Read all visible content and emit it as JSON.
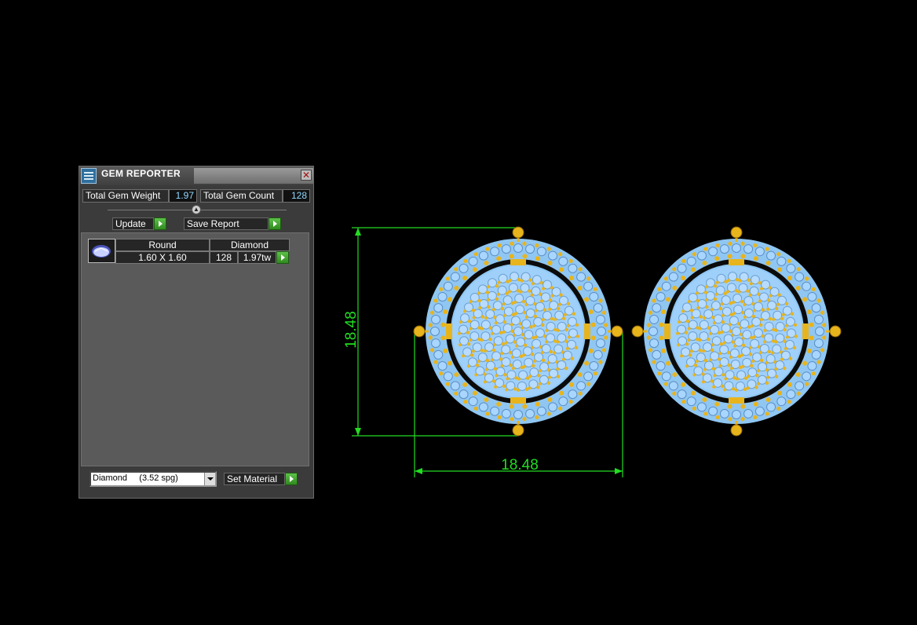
{
  "window": {
    "title": "GEM REPORTER"
  },
  "summary": {
    "weight_label": "Total Gem Weight",
    "weight_value": "1.97",
    "count_label": "Total Gem Count",
    "count_value": "128"
  },
  "actions": {
    "update_label": "Update",
    "save_label": "Save Report"
  },
  "gem_table": {
    "shape": "Round",
    "material": "Diamond",
    "size": "1.60 X 1.60",
    "count": "128",
    "weight": "1.97tw"
  },
  "footer": {
    "material_option": "Diamond     (3.52 spg)",
    "set_material_label": "Set Material"
  },
  "drawing": {
    "dim_height": "18.48",
    "dim_width": "18.48",
    "colors": {
      "dimension": "#22dd22",
      "gold": "#e8b41c",
      "stone": "#8fc6f2",
      "background": "#000000"
    }
  }
}
